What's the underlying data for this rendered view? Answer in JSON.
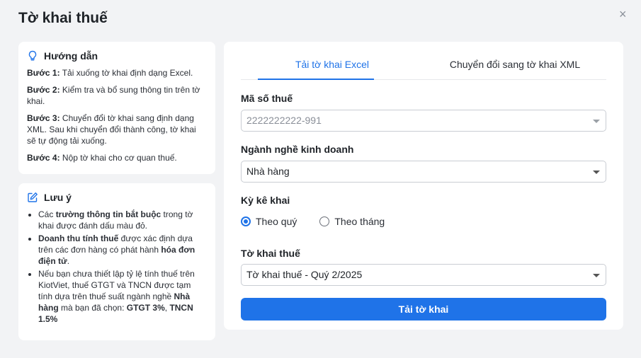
{
  "dialog": {
    "title": "Tờ khai thuế",
    "close_icon": "×"
  },
  "guide": {
    "heading": "Hướng dẫn",
    "steps": [
      {
        "label": "Bước 1:",
        "text": " Tải xuống tờ khai định dạng Excel."
      },
      {
        "label": "Bước 2:",
        "text": " Kiểm tra và bổ sung thông tin trên tờ khai."
      },
      {
        "label": "Bước 3:",
        "text": " Chuyển đổi tờ khai sang định dạng XML. Sau khi chuyển đổi thành công, tờ khai sẽ tự động tải xuống."
      },
      {
        "label": "Bước 4:",
        "text": " Nộp tờ khai cho cơ quan thuế."
      }
    ]
  },
  "notes": {
    "heading": "Lưu ý",
    "n1": {
      "a": "Các ",
      "b": "trường thông tin bắt buộc",
      "c": " trong tờ khai được đánh dấu màu đỏ."
    },
    "n2": {
      "a": "Doanh thu tính thuế",
      "b": " được xác định dựa trên các đơn hàng có phát hành ",
      "c": "hóa đơn điện tử",
      "d": "."
    },
    "n3": {
      "a": "Nếu bạn chưa thiết lập tỷ lệ tính thuế trên KiotViet, thuế GTGT và TNCN được tạm tính dựa trên thuế suất ngành nghề ",
      "b": "Nhà hàng",
      "c": " mà bạn đã chọn: ",
      "d": "GTGT 3%",
      "e": ", ",
      "f": "TNCN 1.5%"
    }
  },
  "tabs": [
    {
      "label": "Tải tờ khai Excel",
      "active": true
    },
    {
      "label": "Chuyển đổi sang tờ khai XML",
      "active": false
    }
  ],
  "form": {
    "tax_code_label": "Mã số thuế",
    "tax_code_value": "2222222222-991",
    "industry_label": "Ngành nghề kinh doanh",
    "industry_value": "Nhà hàng",
    "period_label": "Kỳ kê khai",
    "period_options": [
      {
        "label": "Theo quý",
        "selected": true
      },
      {
        "label": "Theo tháng",
        "selected": false
      }
    ],
    "return_label": "Tờ khai thuế",
    "return_value": "Tờ khai thuế - Quý 2/2025",
    "submit_label": "Tải tờ khai"
  },
  "colors": {
    "accent": "#1f73e8",
    "background": "#f2f3f5",
    "card": "#ffffff"
  }
}
